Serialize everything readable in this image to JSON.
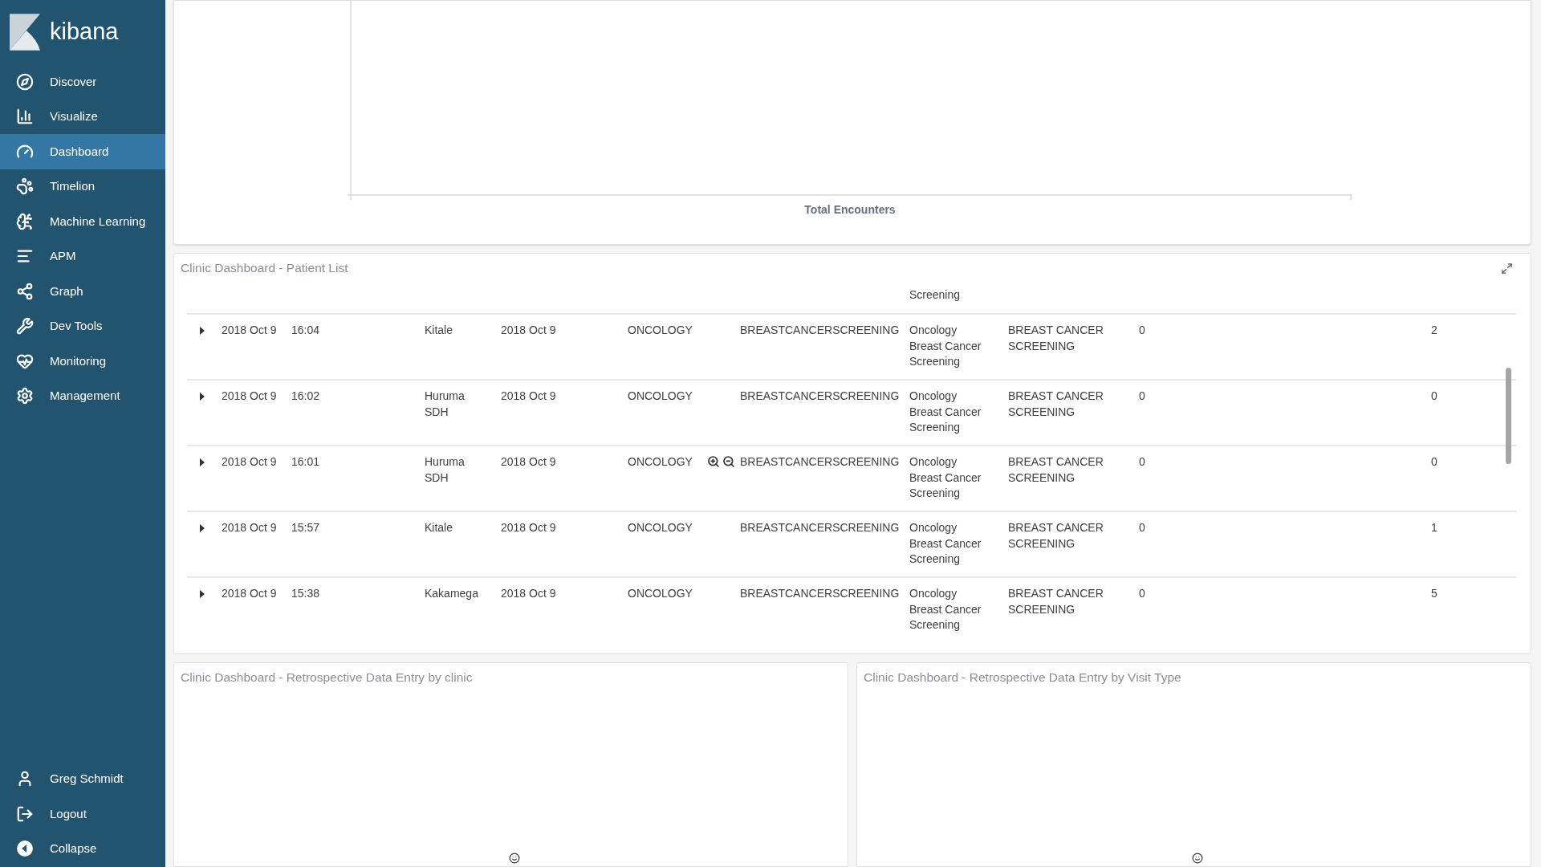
{
  "sidebar": {
    "brand": "kibana",
    "items": [
      {
        "label": "Discover",
        "selected": false
      },
      {
        "label": "Visualize",
        "selected": false
      },
      {
        "label": "Dashboard",
        "selected": true
      },
      {
        "label": "Timelion",
        "selected": false
      },
      {
        "label": "Machine Learning",
        "selected": false
      },
      {
        "label": "APM",
        "selected": false
      },
      {
        "label": "Graph",
        "selected": false
      },
      {
        "label": "Dev Tools",
        "selected": false
      },
      {
        "label": "Monitoring",
        "selected": false
      },
      {
        "label": "Management",
        "selected": false
      }
    ],
    "footer": [
      {
        "label": "Greg Schmidt"
      },
      {
        "label": "Logout"
      },
      {
        "label": "Collapse"
      }
    ]
  },
  "top_panel": {
    "axis_title": "Total Encounters"
  },
  "patient_list": {
    "title": "Clinic Dashboard - Patient List",
    "partial_cell": "Screening",
    "rows": [
      {
        "cells": [
          "2018 Oct 9",
          "16:04",
          "Kitale",
          "2018 Oct 9",
          "ONCOLOGY",
          "BREASTCANCERSCREENING",
          "Oncology Breast Cancer Screening",
          "BREAST CANCER SCREENING",
          "0",
          "2"
        ],
        "hovered": false
      },
      {
        "cells": [
          "2018 Oct 9",
          "16:02",
          "Huruma SDH",
          "2018 Oct 9",
          "ONCOLOGY",
          "BREASTCANCERSCREENING",
          "Oncology Breast Cancer Screening",
          "BREAST CANCER SCREENING",
          "0",
          "0"
        ],
        "hovered": false
      },
      {
        "cells": [
          "2018 Oct 9",
          "16:01",
          "Huruma SDH",
          "2018 Oct 9",
          "ONCOLOGY",
          "BREASTCANCERSCREENING",
          "Oncology Breast Cancer Screening",
          "BREAST CANCER SCREENING",
          "0",
          "0"
        ],
        "hovered": true
      },
      {
        "cells": [
          "2018 Oct 9",
          "15:57",
          "Kitale",
          "2018 Oct 9",
          "ONCOLOGY",
          "BREASTCANCERSCREENING",
          "Oncology Breast Cancer Screening",
          "BREAST CANCER SCREENING",
          "0",
          "1"
        ],
        "hovered": false
      },
      {
        "cells": [
          "2018 Oct 9",
          "15:38",
          "Kakamega",
          "2018 Oct 9",
          "ONCOLOGY",
          "BREASTCANCERSCREENING",
          "Oncology Breast Cancer Screening",
          "BREAST CANCER SCREENING",
          "0",
          "5"
        ],
        "hovered": false
      }
    ]
  },
  "bottom_panels": [
    {
      "title": "Clinic Dashboard - Retrospective Data Entry by clinic"
    },
    {
      "title": "Clinic Dashboard - Retrospective Data Entry by Visit Type"
    }
  ]
}
